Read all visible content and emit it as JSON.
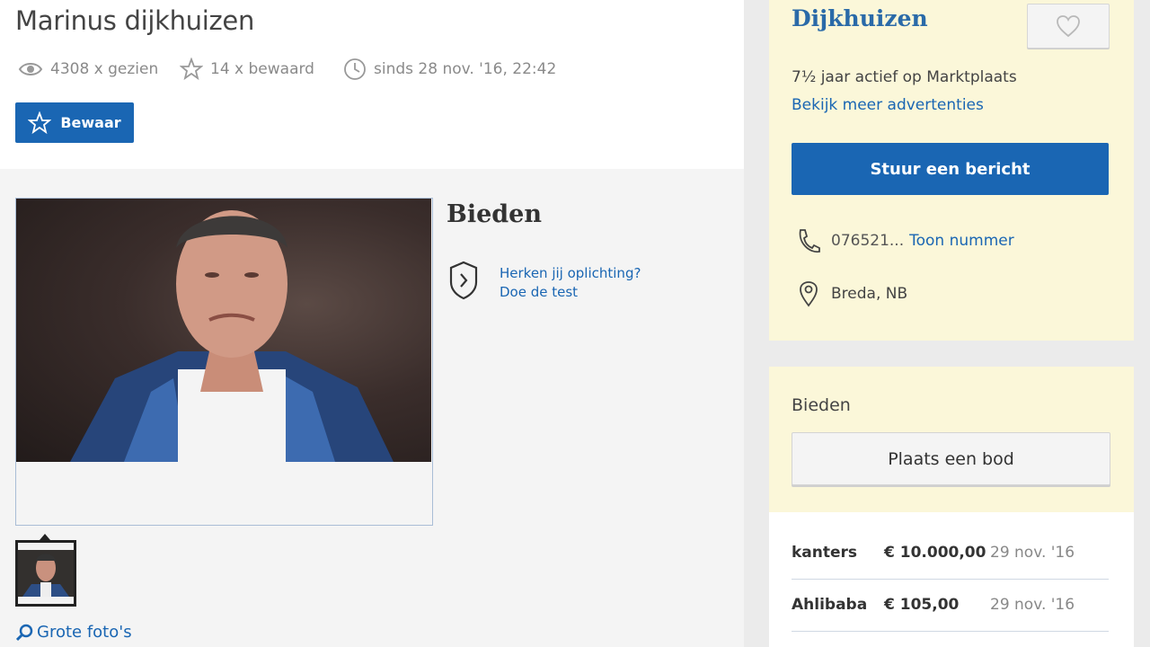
{
  "listing": {
    "title": "Marinus dijkhuizen",
    "views": "4308 x gezien",
    "saves": "14 x bewaard",
    "since": "sinds 28 nov. '16, 22:42",
    "save_label": "Bewaar"
  },
  "main": {
    "bid_heading": "Bieden",
    "scam_line1": "Herken jij oplichting?",
    "scam_line2": "Doe de test",
    "big_photos_label": "Grote foto's"
  },
  "seller": {
    "name": "Dijkhuizen",
    "active_years": "7½ jaar actief op Marktplaats",
    "more_ads": "Bekijk meer advertenties",
    "message_button": "Stuur een bericht",
    "phone_partial": "076521...",
    "show_number": "Toon nummer",
    "location": "Breda, NB"
  },
  "bidding": {
    "heading": "Bieden",
    "place_bid_button": "Plaats een bod",
    "bids": [
      {
        "bidder": "kanters",
        "amount": "€ 10.000,00",
        "date": "29 nov. '16"
      },
      {
        "bidder": "Ahlibaba",
        "amount": "€ 105,00",
        "date": "29 nov. '16"
      }
    ]
  },
  "colors": {
    "primary_blue": "#1a66b3",
    "seller_panel": "#fbf7d9",
    "muted_text": "#8a8a8a"
  },
  "icons": [
    "eye-icon",
    "star-icon",
    "clock-icon",
    "heart-icon",
    "phone-icon",
    "location-pin-icon",
    "shield-icon",
    "magnifier-icon"
  ]
}
